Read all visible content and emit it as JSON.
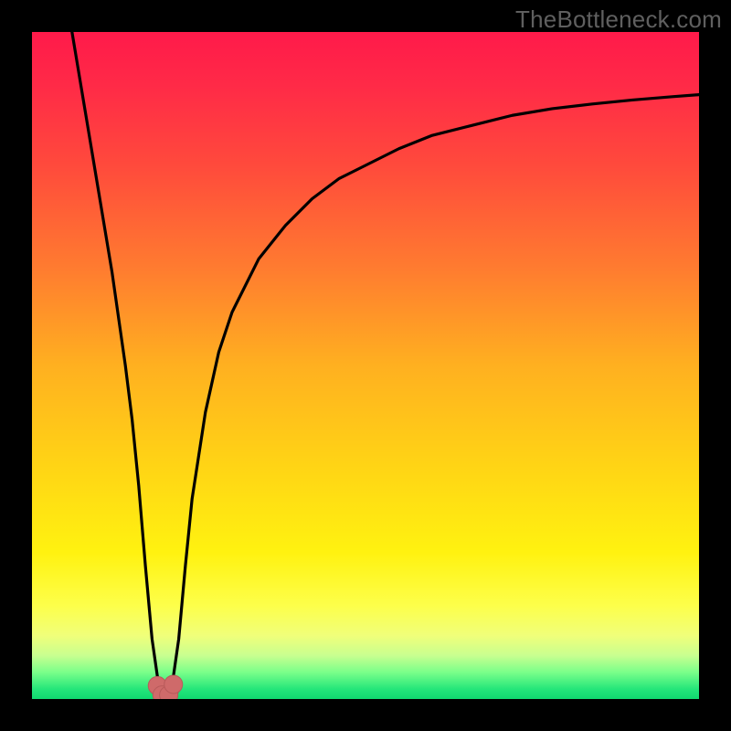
{
  "watermark": "TheBottleneck.com",
  "colors": {
    "frame": "#000000",
    "gradient_stops": [
      {
        "offset": 0.0,
        "color": "#ff1a4a"
      },
      {
        "offset": 0.08,
        "color": "#ff2a47"
      },
      {
        "offset": 0.2,
        "color": "#ff4a3c"
      },
      {
        "offset": 0.35,
        "color": "#ff7a30"
      },
      {
        "offset": 0.5,
        "color": "#ffb020"
      },
      {
        "offset": 0.65,
        "color": "#ffd415"
      },
      {
        "offset": 0.78,
        "color": "#fff210"
      },
      {
        "offset": 0.86,
        "color": "#fdff4a"
      },
      {
        "offset": 0.905,
        "color": "#f0ff7a"
      },
      {
        "offset": 0.935,
        "color": "#c8ff90"
      },
      {
        "offset": 0.96,
        "color": "#7aff8a"
      },
      {
        "offset": 0.985,
        "color": "#25e67a"
      },
      {
        "offset": 1.0,
        "color": "#10d870"
      }
    ],
    "curve": "#000000",
    "marker_fill": "#cf6a6a",
    "marker_stroke": "#b85a5a"
  },
  "chart_data": {
    "type": "line",
    "title": "",
    "xlabel": "",
    "ylabel": "",
    "xlim": [
      0,
      100
    ],
    "ylim": [
      0,
      100
    ],
    "series": [
      {
        "name": "bottleneck-curve",
        "x": [
          6,
          8,
          10,
          12,
          14,
          15,
          16,
          17,
          18,
          19,
          20,
          21,
          22,
          23,
          24,
          26,
          28,
          30,
          34,
          38,
          42,
          46,
          50,
          55,
          60,
          66,
          72,
          78,
          84,
          90,
          96,
          100
        ],
        "y": [
          100,
          88,
          76,
          64,
          50,
          42,
          32,
          20,
          9,
          2,
          0,
          2,
          9,
          20,
          30,
          43,
          52,
          58,
          66,
          71,
          75,
          78,
          80,
          82.5,
          84.5,
          86,
          87.5,
          88.5,
          89.2,
          89.8,
          90.3,
          90.6
        ]
      }
    ],
    "markers": [
      {
        "x": 18.8,
        "y": 2.0
      },
      {
        "x": 19.5,
        "y": 0.6
      },
      {
        "x": 20.5,
        "y": 0.6
      },
      {
        "x": 21.2,
        "y": 2.2
      }
    ],
    "notes": "y represents bottleneck percentage; minimum (optimal) around x≈20"
  }
}
